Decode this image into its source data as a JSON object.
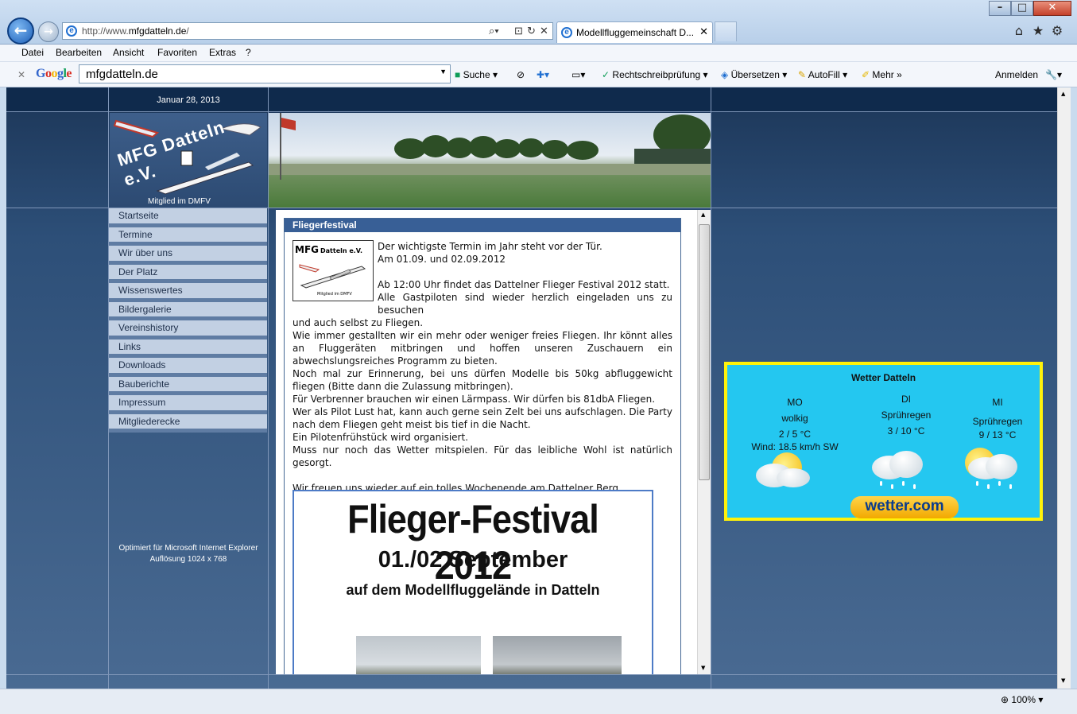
{
  "browser": {
    "address": {
      "prefix": "http://www.",
      "domain": "mfgdatteln.de",
      "suffix": "/"
    },
    "tab_title": "Modellfluggemeinschaft D...",
    "menu": [
      "Datei",
      "Bearbeiten",
      "Ansicht",
      "Favoriten",
      "Extras",
      "?"
    ],
    "google_toolbar": {
      "logo": "Google",
      "search_value": "mfgdatteln.de",
      "suche": "Suche",
      "spell": "Rechtschreibprüfung",
      "translate": "Übersetzen",
      "autofill": "AutoFill",
      "more": "Mehr",
      "signin": "Anmelden"
    },
    "zoom": "100%"
  },
  "site": {
    "date": "Januar 28, 2013",
    "logo_title": "MFG Datteln e.V.",
    "logo_sub": "Mitglied im DMFV",
    "nav": [
      "Startseite",
      "Termine",
      "Wir über uns",
      "Der Platz",
      "Wissenswertes",
      "Bildergalerie",
      "Vereinshistory",
      "Links",
      "Downloads",
      "Bauberichte",
      "Impressum",
      "Mitgliederecke"
    ],
    "optimized_line1": "Optimiert für Microsoft Internet Explorer",
    "optimized_line2": "Auflösung 1024 x 768"
  },
  "article": {
    "heading": "Fliegerfestival",
    "mini_logo": {
      "mfg": "MFG",
      "datteln": "Datteln e.V.",
      "member": "Mitglied im DMFV"
    },
    "p1": "Der wichtigste Termin im Jahr steht vor der Tür.",
    "p2": "Am 01.09. und 02.09.2012",
    "p3": "Ab 12:00 Uhr findet das Dattelner Flieger Festival 2012 statt.",
    "p4a": "Alle Gastpiloten sind wieder herzlich eingeladen uns zu besuchen",
    "p4b": "und auch selbst zu Fliegen.",
    "p5": "Wie immer gestallten wir ein mehr oder weniger freies Fliegen. Ihr könnt alles an Fluggeräten mitbringen und hoffen unseren Zuschauern ein abwechslungsreiches Programm zu bieten.",
    "p6": "Noch mal zur Erinnerung, bei uns dürfen Modelle bis 50kg abfluggewicht fliegen (Bitte dann die Zulassung mitbringen).",
    "p7": "Für Verbrenner brauchen wir einen Lärmpass. Wir dürfen bis 81dbA Fliegen.",
    "p8": "Wer als Pilot Lust hat, kann auch gerne sein Zelt bei uns aufschlagen. Die Party nach dem Fliegen geht meist bis tief in die Nacht.",
    "p9": "Ein Pilotenfrühstück wird organisiert.",
    "p10": "Muss nur noch das Wetter mitspielen. Für das leibliche Wohl ist natürlich gesorgt.",
    "p11": "Wir freuen uns wieder auf ein tolles Wochenende am Dattelner Berg.",
    "poster": {
      "title": "Flieger-Festival 2012",
      "date": "01./02 September",
      "sub": "auf dem Modellfluggelände in Datteln"
    }
  },
  "weather": {
    "title": "Wetter Datteln",
    "days": [
      {
        "day": "MO",
        "cond": "wolkig",
        "temp": "2 / 5 °C",
        "wind": "Wind: 18.5 km/h SW"
      },
      {
        "day": "DI",
        "cond": "Sprühregen",
        "temp": "3 / 10 °C"
      },
      {
        "day": "MI",
        "cond": "Sprühregen",
        "temp": "9 / 13 °C"
      }
    ],
    "brand": "wetter.com"
  }
}
